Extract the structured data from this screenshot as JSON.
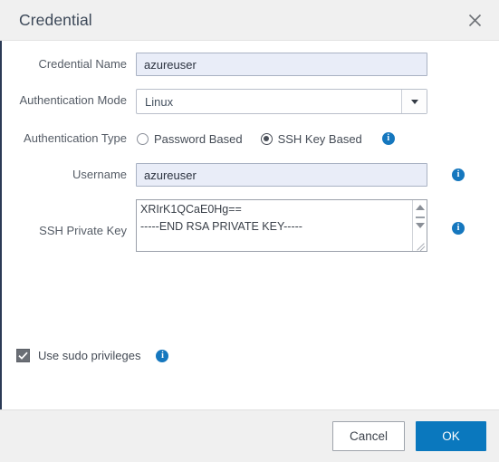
{
  "dialog": {
    "title": "Credential",
    "close_icon": "close-icon"
  },
  "form": {
    "credential_name": {
      "label": "Credential Name",
      "value": "azureuser",
      "placeholder": ""
    },
    "authentication_mode": {
      "label": "Authentication Mode",
      "value": "Linux",
      "options": [
        "Linux"
      ],
      "arrow_icon": "chevron-down-icon"
    },
    "authentication_type": {
      "label": "Authentication Type",
      "options": [
        {
          "label": "Password Based",
          "selected": false
        },
        {
          "label": "SSH Key Based",
          "selected": true
        }
      ],
      "info_icon": "info-icon"
    },
    "username": {
      "label": "Username",
      "value": "azureuser",
      "placeholder": "",
      "info_icon": "info-icon"
    },
    "ssh_private_key": {
      "label": "SSH Private Key",
      "line1": "XRIrK1QCaE0Hg==",
      "line2": "-----END RSA PRIVATE KEY-----",
      "info_icon": "info-icon",
      "scroll_up_icon": "scroll-up-arrow-icon",
      "scroll_down_icon": "scroll-down-arrow-icon",
      "resize_icon": "resize-grip-icon"
    },
    "use_sudo": {
      "label": "Use sudo privileges",
      "checked": true,
      "check_icon": "check-icon",
      "info_icon": "info-icon"
    }
  },
  "footer": {
    "cancel_label": "Cancel",
    "ok_label": "OK"
  },
  "colors": {
    "accent": "#0a78be",
    "info": "#1577be",
    "header_bg": "#f0f0f0",
    "input_filled_bg": "#e9edf8",
    "left_border": "#2b3a55"
  }
}
